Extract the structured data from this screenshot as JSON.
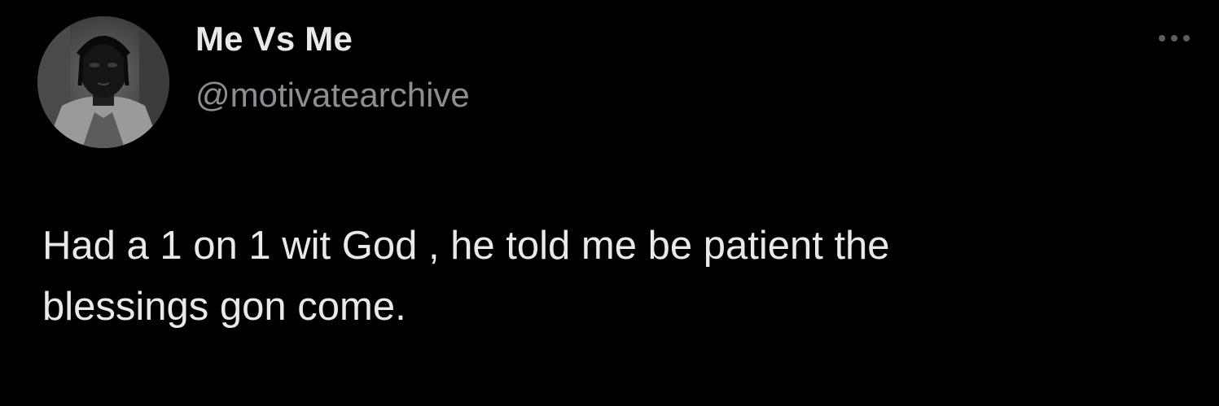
{
  "tweet": {
    "display_name": "Me Vs Me",
    "handle": "@motivatearchive",
    "text": "Had a 1 on 1 wit God , he told me be patient the\nblessings gon come.",
    "more_icon": "more-horizontal-icon",
    "avatar_icon": "profile-photo"
  },
  "colors": {
    "background": "#000000",
    "primary_text": "#e7e9ea",
    "secondary_text": "#8b8f94",
    "icon_muted": "#5a5e62"
  }
}
